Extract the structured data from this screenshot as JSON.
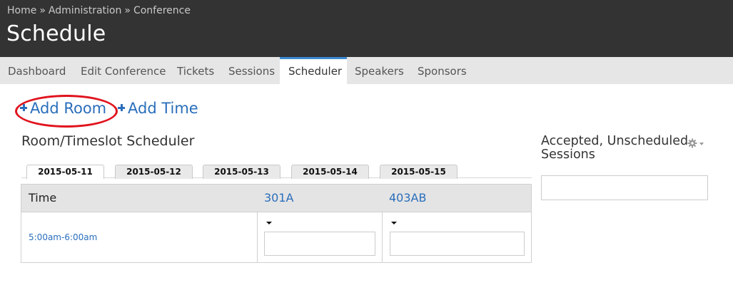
{
  "breadcrumb": {
    "home": "Home",
    "admin": "Administration",
    "conference": "Conference",
    "separator": "»"
  },
  "page": {
    "title": "Schedule"
  },
  "nav": {
    "tabs": [
      "Dashboard",
      "Edit Conference",
      "Tickets",
      "Sessions",
      "Scheduler",
      "Speakers",
      "Sponsors"
    ],
    "active": "Scheduler"
  },
  "actions": {
    "add_room": "Add Room",
    "add_time": "Add Time"
  },
  "scheduler": {
    "title": "Room/Timeslot Scheduler",
    "dates": [
      "2015-05-11",
      "2015-05-12",
      "2015-05-13",
      "2015-05-14",
      "2015-05-15"
    ],
    "active_date": "2015-05-11",
    "columns": {
      "time": "Time",
      "rooms": [
        "301A",
        "403AB"
      ]
    },
    "rows": [
      {
        "timeslot": "5:00am-6:00am"
      }
    ]
  },
  "sidebar": {
    "title": "Accepted, Unscheduled Sessions"
  },
  "colors": {
    "header_bg": "#333333",
    "link": "#2a6ebb",
    "highlight": "#e0131d",
    "nav_active_border": "#3b8ad2"
  },
  "icons": {
    "plus": "plus-icon",
    "gear": "gear-icon",
    "caret": "caret-down-icon"
  }
}
